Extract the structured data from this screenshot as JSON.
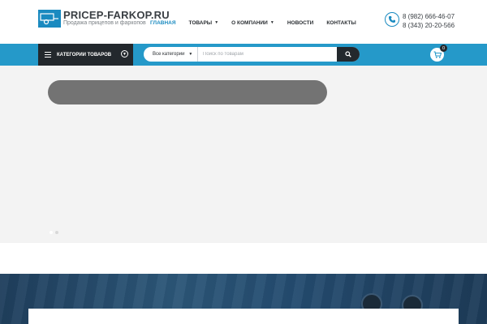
{
  "header": {
    "logo_title": "PRICEP-FARKOP.RU",
    "logo_subtitle": "Продажа прицепов и фаркопов",
    "nav": [
      {
        "label": "ГЛАВНАЯ",
        "active": true
      },
      {
        "label": "ТОВАРЫ",
        "dropdown": true
      },
      {
        "label": "О КОМПАНИИ",
        "dropdown": true
      },
      {
        "label": "НОВОСТИ"
      },
      {
        "label": "КОНТАКТЫ"
      }
    ],
    "phones": [
      "8 (982) 666-46-07",
      "8 (343) 20-20-566"
    ]
  },
  "toolbar": {
    "categories_label": "КАТЕГОРИИ ТОВАРОВ",
    "search_category": "Все категории",
    "search_placeholder": "Поиск по товарам",
    "cart_count": "0"
  },
  "slider": {
    "dots": 2,
    "active_dot": 1
  },
  "colors": {
    "accent": "#2599c9",
    "dark": "#23282d",
    "slider_bg": "#f3f3f3",
    "slide_bar": "#737373"
  }
}
